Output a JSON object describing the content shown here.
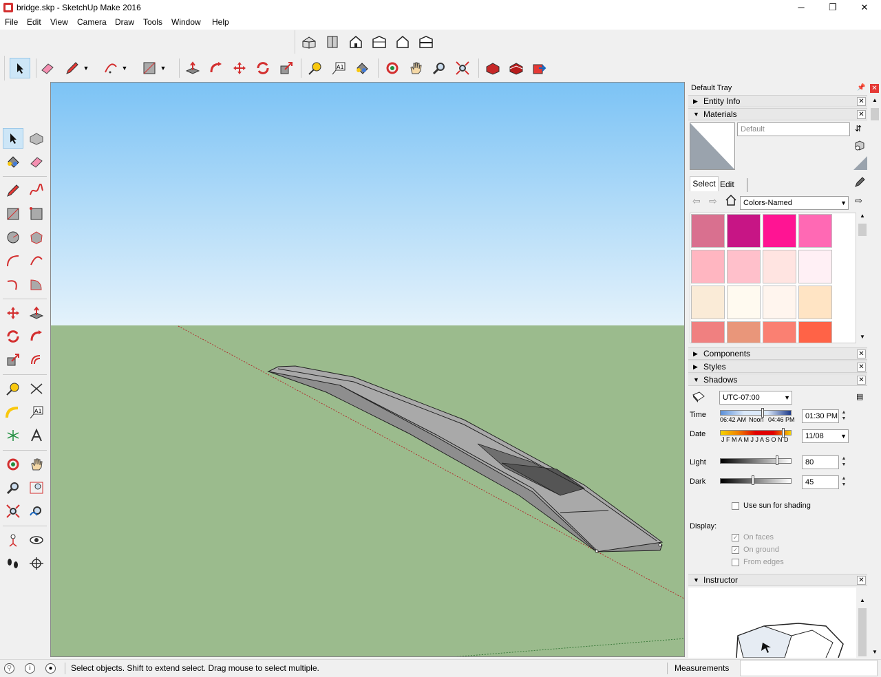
{
  "window": {
    "title": "bridge.skp - SketchUp Make 2016",
    "minimize": "─",
    "restore": "❐",
    "close": "✕"
  },
  "menu": [
    "File",
    "Edit",
    "View",
    "Camera",
    "Draw",
    "Tools",
    "Window",
    "Help"
  ],
  "toolbar_views": [
    "iso-view-icon",
    "top-view-icon",
    "front-view-icon",
    "right-view-icon",
    "back-view-icon",
    "left-view-icon"
  ],
  "toolbar_main": [
    "select-icon",
    "eraser-icon",
    "pencil-icon",
    "arc-icon",
    "rectangle-icon",
    "push-pull-icon",
    "follow-me-icon",
    "move-icon",
    "rotate-icon",
    "scale-icon",
    "tape-measure-icon",
    "text-icon",
    "paint-bucket-icon",
    "orbit-icon",
    "pan-icon",
    "zoom-icon",
    "zoom-extents-icon",
    "3d-warehouse-icon",
    "extension-warehouse-icon",
    "share-model-icon"
  ],
  "tray": {
    "title": "Default Tray",
    "entity_info": "Entity Info",
    "materials": "Materials",
    "material_name_placeholder": "Default",
    "tab_select": "Select",
    "tab_edit": "Edit",
    "library": "Colors-Named",
    "swatches": [
      "#d9708f",
      "#c71585",
      "#ff1493",
      "#ff69b4",
      "#ffb6c1",
      "#ffc0cb",
      "#ffe4e1",
      "#fff0f5",
      "#faebd7",
      "#fffaf0",
      "#fff5ee",
      "#ffe4c4",
      "#f08080",
      "#e9967a",
      "#fa8072",
      "#ff6347"
    ],
    "components": "Components",
    "styles": "Styles",
    "shadows": "Shadows",
    "timezone": "UTC-07:00",
    "time_label": "Time",
    "time_start": "06:42 AM",
    "time_noon": "Noon",
    "time_end": "04:46 PM",
    "time_value": "01:30 PM",
    "date_label": "Date",
    "months": "J F M A M J J A S O N D",
    "date_value": "11/08",
    "light_label": "Light",
    "light_value": "80",
    "dark_label": "Dark",
    "dark_value": "45",
    "use_sun": "Use sun for shading",
    "display_label": "Display:",
    "on_faces": "On faces",
    "on_ground": "On ground",
    "from_edges": "From edges",
    "instructor": "Instructor"
  },
  "status": {
    "message": "Select objects. Shift to extend select. Drag mouse to select multiple.",
    "measurements_label": "Measurements",
    "measurements_value": ""
  }
}
